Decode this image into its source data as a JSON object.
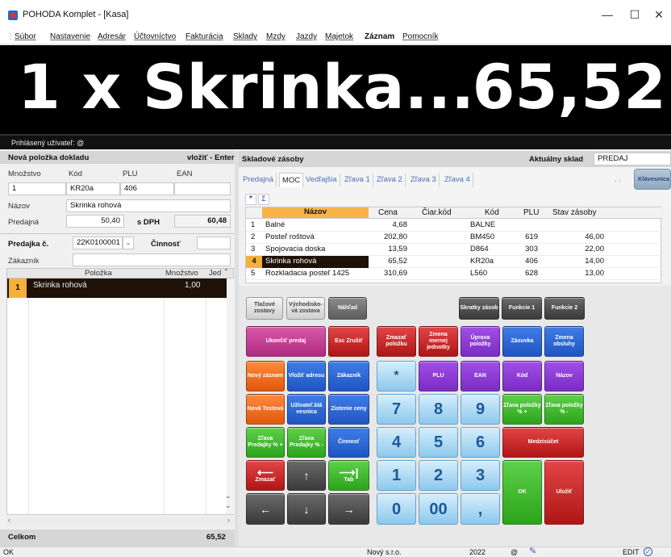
{
  "window": {
    "title": "POHODA Komplet - [Kasa]",
    "minimize": "—",
    "maximize": "☐",
    "close": "✕"
  },
  "menu": [
    {
      "label": "Súbor"
    },
    {
      "label": "Nastavenie"
    },
    {
      "label": "Adresár"
    },
    {
      "label": "Účtovníctvo"
    },
    {
      "label": "Fakturácia"
    },
    {
      "label": "Sklady"
    },
    {
      "label": "Mzdy"
    },
    {
      "label": "Jazdy"
    },
    {
      "label": "Majetok"
    },
    {
      "label": "Záznam"
    },
    {
      "label": "Pomocník"
    }
  ],
  "display": {
    "item": "1 x Skrinka...",
    "price": "65,52"
  },
  "user_bar": "Prihlásený užívateľ: @",
  "new_item": {
    "header": "Nová položka dokladu",
    "hint": "vložiť - Enter",
    "qty_label": "Množstvo",
    "code_label": "Kód",
    "plu_label": "PLU",
    "ean_label": "EAN",
    "qty": "1",
    "code": "KR20a",
    "plu": "406",
    "ean": "",
    "name_label": "Názov",
    "name": "Skrinka rohová",
    "price_label": "Predajná",
    "price": "50,40",
    "vat_label": "s DPH",
    "price_vat": "60,48"
  },
  "sale": {
    "number_label": "Predajka č.",
    "number": "22K0100001",
    "activity_label": "Činnosť",
    "activity": "",
    "customer_label": "Zákazník",
    "customer": "",
    "col_item": "Položka",
    "col_qty": "Množstvo",
    "col_unit": "Jed",
    "rows": [
      {
        "idx": "1",
        "item": "Skrinka rohová",
        "qty": "1,00",
        "unit": ""
      }
    ],
    "total_label": "Celkom",
    "total": "65,52"
  },
  "stock": {
    "header": "Skladové zásoby",
    "current_label": "Aktuálny sklad",
    "current": "PREDAJ",
    "keyboard_btn": "Klávesnica",
    "tabs": [
      "Predajná",
      "MOC",
      "Vedľajšia",
      "Zľava 1",
      "Zľava 2",
      "Zľava 3",
      "Zľava 4"
    ],
    "filter_star": "*",
    "filter_sigma": "Σ",
    "columns": [
      "Názov",
      "Cena",
      "Čiar.kód",
      "Kód",
      "PLU",
      "Stav zásoby"
    ],
    "rows": [
      {
        "idx": "1",
        "name": "Balné",
        "price": "4,68",
        "ean": "",
        "code": "BALNE",
        "plu": "",
        "stock": ""
      },
      {
        "idx": "2",
        "name": "Posteľ roštová",
        "price": "202,80",
        "ean": "",
        "code": "BM450",
        "plu": "619",
        "stock": "46,00"
      },
      {
        "idx": "3",
        "name": "Spojovacia doska",
        "price": "13,59",
        "ean": "",
        "code": "D864",
        "plu": "303",
        "stock": "22,00"
      },
      {
        "idx": "4",
        "name": "Skrinka rohová",
        "price": "65,52",
        "ean": "",
        "code": "KR20a",
        "plu": "406",
        "stock": "14,00"
      },
      {
        "idx": "5",
        "name": "Rozkladacia posteľ 1425",
        "price": "310,69",
        "ean": "",
        "code": "L560",
        "plu": "628",
        "stock": "13,00"
      }
    ]
  },
  "keys": {
    "print_shifts": "Tlačové zostavy",
    "default_shift": "Východisko­vá zostava",
    "preview": "Náhľad",
    "shortcuts": "Skratky zásob",
    "func1": "Funkcie 1",
    "func2": "Funkcie 2",
    "end_sale": "Ukončiť predaj",
    "esc": "Esc Zrušiť",
    "delete_item": "Zmazať položku",
    "change_unit": "Zmena mernej jednotky",
    "edit_item": "Úprava položky",
    "drawer": "Zásuvka",
    "change_staff": "Zmena obsluhy",
    "new_record": "Nový záznam",
    "insert_address": "Vložiť adresu",
    "customer": "Zákazník",
    "star": "*",
    "plu": "PLU",
    "ean": "EAN",
    "code": "Kód",
    "name": "Názov",
    "new_text": "Nová Textová",
    "user_key": "Užívateľ.klá vesnica",
    "price_check": "Zistenie ceny",
    "disc_item_plus": "Zľava položky % +",
    "disc_item_minus": "Zľava položky % -",
    "disc_sale_plus": "Zľava Predajky % +",
    "disc_sale_minus": "Zľava Predajky % -",
    "activity": "Činnosť",
    "subtotal": "Medzisúčet",
    "backspace_label": "Zmazať",
    "tab_label": "Tab",
    "n7": "7",
    "n8": "8",
    "n9": "9",
    "n4": "4",
    "n5": "5",
    "n6": "6",
    "n1": "1",
    "n2": "2",
    "n3": "3",
    "n0": "0",
    "n00": "00",
    "comma": ",",
    "ok": "OK",
    "save": "Uložiť"
  },
  "status": {
    "left": "OK",
    "company": "Nový s.r.o.",
    "year": "2022",
    "at": "@",
    "mode": "EDIT"
  }
}
